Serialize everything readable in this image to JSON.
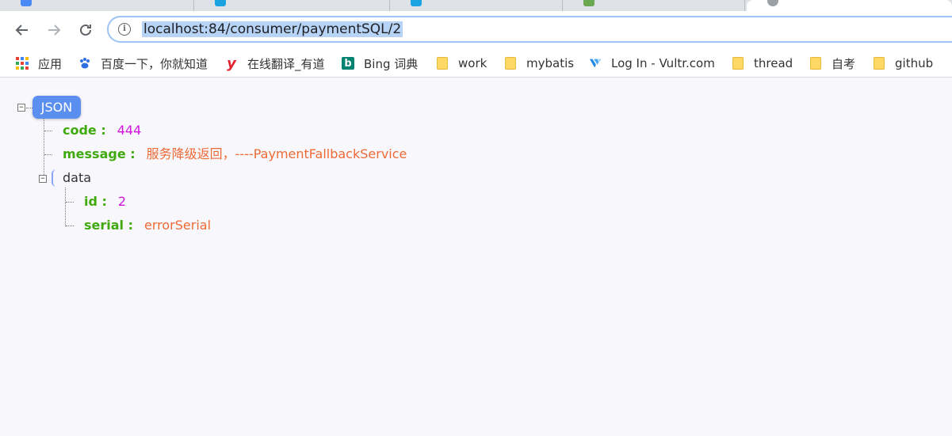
{
  "browser": {
    "tabs": [
      {
        "favicon_color": "#4a8af4",
        "title": "…"
      },
      {
        "favicon_color": "#1aa3e0",
        "title": "…"
      },
      {
        "favicon_color": "#1aa3e0",
        "title": "…"
      },
      {
        "favicon_color": "#6aa84f",
        "title": ""
      },
      {
        "favicon_color": "#9aa0a6",
        "title": "",
        "active": true
      }
    ],
    "url": "localhost:84/consumer/paymentSQL/2",
    "bookmarks": [
      {
        "label": "应用",
        "icon": "apps-grid-icon"
      },
      {
        "label": "百度一下，你就知道",
        "icon": "baidu-paw-icon"
      },
      {
        "label": "在线翻译_有道",
        "icon": "youdao-icon"
      },
      {
        "label": "Bing 词典",
        "icon": "bing-icon"
      },
      {
        "label": "work",
        "icon": "folder-icon"
      },
      {
        "label": "mybatis",
        "icon": "folder-icon"
      },
      {
        "label": "Log In - Vultr.com",
        "icon": "vultr-icon"
      },
      {
        "label": "thread",
        "icon": "folder-icon"
      },
      {
        "label": "自考",
        "icon": "folder-icon"
      },
      {
        "label": "github",
        "icon": "folder-icon"
      }
    ]
  },
  "json_view": {
    "root_label": "JSON",
    "code": {
      "key": "code :",
      "value": "444"
    },
    "message": {
      "key": "message :",
      "value": "服务降级返回，----PaymentFallbackService"
    },
    "data": {
      "key": "data",
      "id": {
        "key": "id :",
        "value": "2"
      },
      "serial": {
        "key": "serial :",
        "value": "errorSerial"
      }
    }
  },
  "colors": {
    "key": "#3fa90e",
    "number": "#d213e0",
    "string": "#ee6a35",
    "root_badge": "#5a8eef"
  }
}
